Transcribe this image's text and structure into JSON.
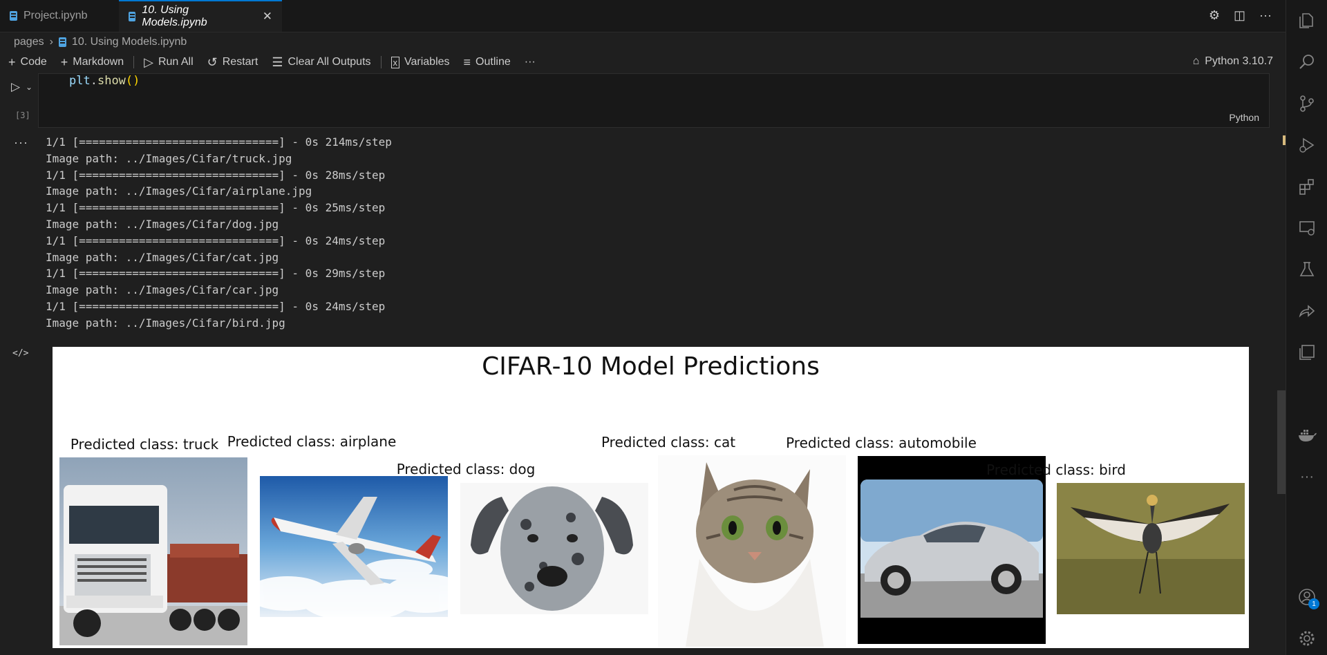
{
  "tabs": [
    {
      "label": "Project.ipynb",
      "active": false
    },
    {
      "label": "10. Using Models.ipynb",
      "active": true
    }
  ],
  "breadcrumb": {
    "folder": "pages",
    "file": "10. Using Models.ipynb"
  },
  "toolbar": {
    "code_label": "Code",
    "markdown_label": "Markdown",
    "run_all_label": "Run All",
    "restart_label": "Restart",
    "clear_outputs_label": "Clear All Outputs",
    "variables_label": "Variables",
    "outline_label": "Outline",
    "more_label": "···",
    "kernel_label": "Python 3.10.7"
  },
  "cell": {
    "execution_count": "[3]",
    "code_obj": "plt",
    "code_fn": "show",
    "language": "Python"
  },
  "output": {
    "lines": [
      "1/1 [==============================] - 0s 214ms/step",
      "Image path: ../Images/Cifar/truck.jpg",
      "1/1 [==============================] - 0s 28ms/step",
      "Image path: ../Images/Cifar/airplane.jpg",
      "1/1 [==============================] - 0s 25ms/step",
      "Image path: ../Images/Cifar/dog.jpg",
      "1/1 [==============================] - 0s 24ms/step",
      "Image path: ../Images/Cifar/cat.jpg",
      "1/1 [==============================] - 0s 29ms/step",
      "Image path: ../Images/Cifar/car.jpg",
      "1/1 [==============================] - 0s 24ms/step",
      "Image path: ../Images/Cifar/bird.jpg"
    ]
  },
  "figure": {
    "title": "CIFAR-10 Model Predictions",
    "predictions": [
      {
        "caption": "Predicted class: truck"
      },
      {
        "caption": "Predicted class: airplane"
      },
      {
        "caption": "Predicted class: dog"
      },
      {
        "caption": "Predicted class: cat"
      },
      {
        "caption": "Predicted class: automobile"
      },
      {
        "caption": "Predicted class: bird"
      }
    ]
  },
  "activity_bar": {
    "icons": [
      "explorer-icon",
      "search-icon",
      "source-control-icon",
      "run-debug-icon",
      "extensions-icon",
      "remote-explorer-icon",
      "testing-icon",
      "live-share-icon",
      "jupyter-icon",
      "docker-icon",
      "more-icon"
    ],
    "accounts_badge": "1"
  },
  "colors": {
    "accent": "#0078d4",
    "background": "#1f1f1f",
    "figure_bg": "#ffffff"
  }
}
